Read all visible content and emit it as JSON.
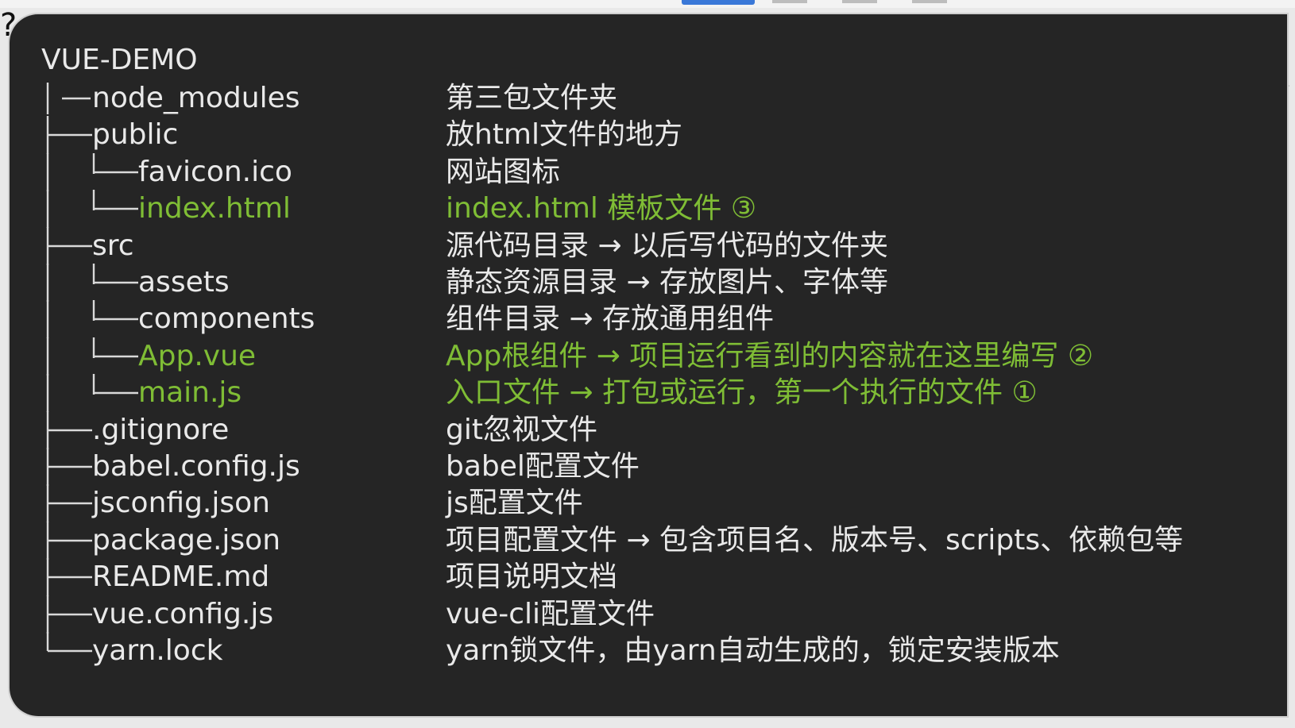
{
  "root": {
    "title": "VUE-DEMO"
  },
  "colors": {
    "panel_bg": "#252525",
    "text": "#e9e9e9",
    "highlight": "#7fbd35",
    "tree_line": "#d9d9d9"
  },
  "rows": [
    {
      "name": "node_modules",
      "desc": "第三包文件夹",
      "depth": 1,
      "highlight": false
    },
    {
      "name": "public",
      "desc": "放html文件的地方",
      "depth": 1,
      "highlight": false
    },
    {
      "name": "favicon.ico",
      "desc": "网站图标",
      "depth": 2,
      "highlight": false
    },
    {
      "name": "index.html",
      "desc": "index.html 模板文件 ③",
      "depth": 2,
      "highlight": true
    },
    {
      "name": "src",
      "desc": "源代码目录 → 以后写代码的文件夹",
      "depth": 1,
      "highlight": false
    },
    {
      "name": "assets",
      "desc": "静态资源目录 → 存放图片、字体等",
      "depth": 2,
      "highlight": false
    },
    {
      "name": "components",
      "desc": "组件目录 → 存放通用组件",
      "depth": 2,
      "highlight": false
    },
    {
      "name": "App.vue",
      "desc": "App根组件 → 项目运行看到的内容就在这里编写 ②",
      "depth": 2,
      "highlight": true
    },
    {
      "name": "main.js",
      "desc": "入口文件 → 打包或运行，第一个执行的文件 ①",
      "depth": 2,
      "highlight": true
    },
    {
      "name": ".gitignore",
      "desc": "git忽视文件",
      "depth": 1,
      "highlight": false
    },
    {
      "name": "babel.config.js",
      "desc": "babel配置文件",
      "depth": 1,
      "highlight": false
    },
    {
      "name": "jsconfig.json",
      "desc": "js配置文件",
      "depth": 1,
      "highlight": false
    },
    {
      "name": "package.json",
      "desc": "项目配置文件 → 包含项目名、版本号、scripts、依赖包等",
      "depth": 1,
      "highlight": false
    },
    {
      "name": "README.md",
      "desc": "项目说明文档",
      "depth": 1,
      "highlight": false
    },
    {
      "name": "vue.config.js",
      "desc": "vue-cli配置文件",
      "depth": 1,
      "highlight": false
    },
    {
      "name": "yarn.lock",
      "desc": "yarn锁文件，由yarn自动生成的，锁定安装版本",
      "depth": 1,
      "highlight": false
    }
  ]
}
